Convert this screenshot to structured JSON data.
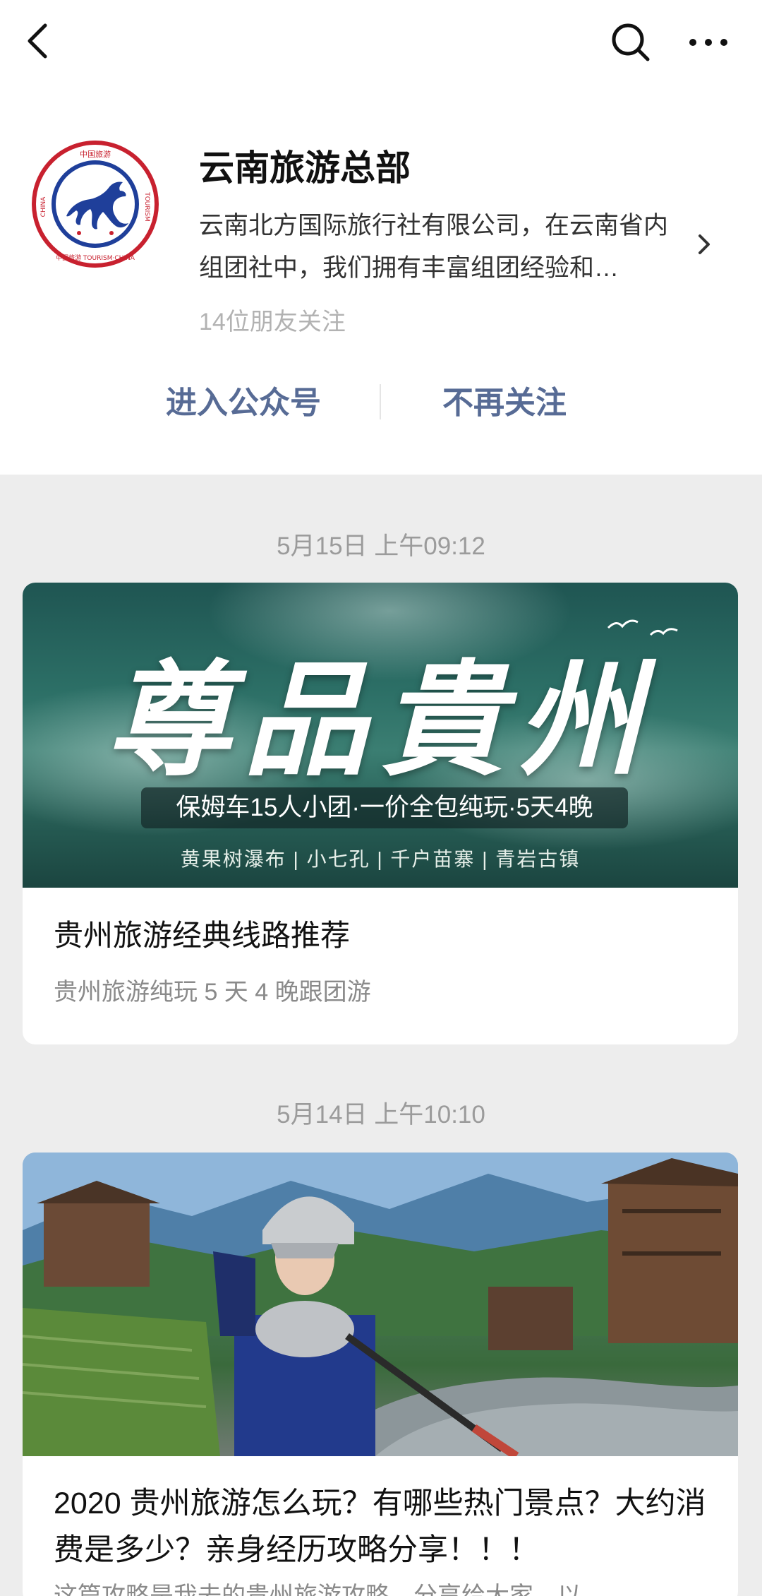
{
  "nav": {
    "back_icon": "chevron-left-icon",
    "search_icon": "search-icon",
    "more_icon": "more-icon"
  },
  "account": {
    "name": "云南旅游总部",
    "description": "云南北方国际旅行社有限公司，在云南省内组团社中，我们拥有丰富组团经验和…",
    "friends_following": "14位朋友关注",
    "logo_text_top": "中国旅游",
    "logo_text_left": "CHINA",
    "logo_text_right": "TOURISM",
    "logo_text_bottom": "中国旅游 TOURISM·CHINA"
  },
  "actions": {
    "enter_label": "进入公众号",
    "unfollow_label": "不再关注"
  },
  "feed": [
    {
      "date": "5月15日 上午09:12",
      "cover_title": "尊品貴州",
      "cover_banner": "保姆车15人小团·一价全包纯玩·5天4晚",
      "cover_sub": "黄果树瀑布 | 小七孔 | 千户苗寨 | 青岩古镇",
      "title": "贵州旅游经典线路推荐",
      "digest": "贵州旅游纯玩 5 天 4 晚跟团游"
    },
    {
      "date": "5月14日 上午10:10",
      "title": "2020 贵州旅游怎么玩？有哪些热门景点？大约消费是多少？亲身经历攻略分享！！！",
      "digest": "这篇攻略是我去的贵州旅游攻略，分享给大家，以"
    }
  ],
  "colors": {
    "link": "#576b95",
    "background": "#ededed",
    "muted": "#b2b2b2"
  }
}
